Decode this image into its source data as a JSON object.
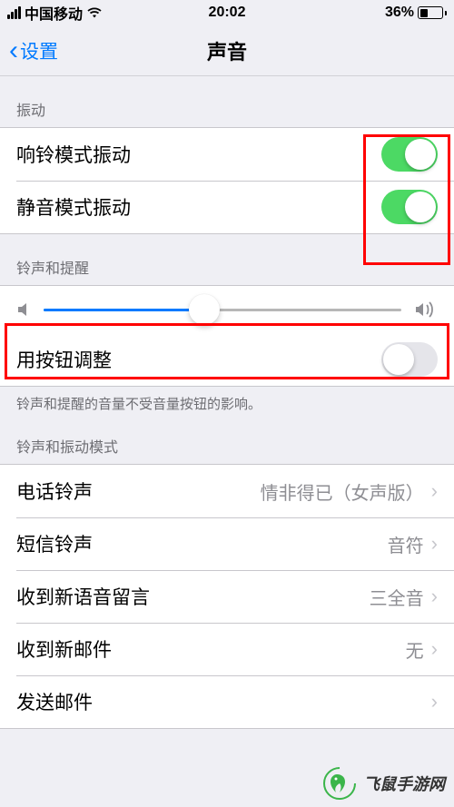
{
  "statusBar": {
    "carrier": "中国移动",
    "time": "20:02",
    "batteryPercent": "36%"
  },
  "nav": {
    "back": "设置",
    "title": "声音"
  },
  "sections": {
    "vibrationHeader": "振动",
    "ringVibrate": "响铃模式振动",
    "silentVibrate": "静音模式振动",
    "ringerHeader": "铃声和提醒",
    "buttonChange": "用按钮调整",
    "ringerFooter": "铃声和提醒的音量不受音量按钮的影响。",
    "modesHeader": "铃声和振动模式"
  },
  "volumeSliderPercent": 45,
  "rows": {
    "ringtone": {
      "label": "电话铃声",
      "value": "情非得已（女声版）"
    },
    "textTone": {
      "label": "短信铃声",
      "value": "音符"
    },
    "voicemail": {
      "label": "收到新语音留言",
      "value": "三全音"
    },
    "newMail": {
      "label": "收到新邮件",
      "value": "无"
    },
    "sentMail": {
      "label": "发送邮件",
      "value": ""
    }
  },
  "watermark": "飞鼠手游网"
}
